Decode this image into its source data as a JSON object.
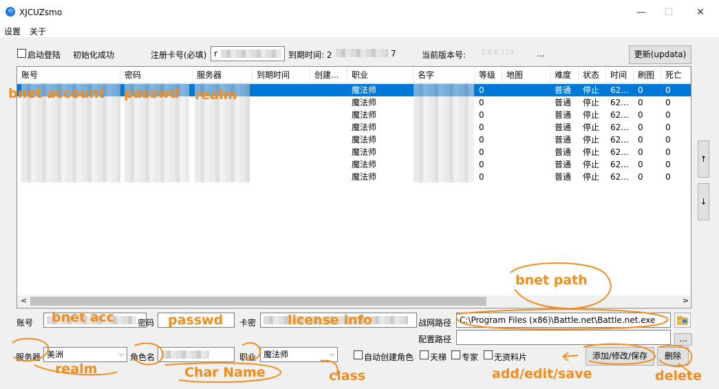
{
  "window": {
    "title": "XJCUZsmo",
    "minimize": "—",
    "maximize": "☐",
    "close": "✕"
  },
  "menu": [
    "设置",
    "关于"
  ],
  "toolbar": {
    "auto_login_label": "启动登陆",
    "init_status": "初始化成功",
    "reg_card_label": "注册卡号(必填)",
    "reg_card_value": "r",
    "expire_label": "到期时间: 2",
    "expire_tail": "7",
    "version_label": "当前版本号:",
    "version_value": "1.0.0.120",
    "version_more": "...",
    "update_button": "更新(updata)"
  },
  "table": {
    "columns": [
      "账号",
      "密码",
      "服务器",
      "到期时间",
      "创建...",
      "职业",
      "名字",
      "等级",
      "地图",
      "难度",
      "状态",
      "时间",
      "刷图",
      "死亡"
    ],
    "rows": [
      {
        "class": "魔法师",
        "level": "0",
        "difficulty": "普通",
        "state": "停止",
        "time": "62...",
        "runs": "0",
        "deaths": "0",
        "selected": true
      },
      {
        "class": "魔法师",
        "level": "0",
        "difficulty": "普通",
        "state": "停止",
        "time": "62...",
        "runs": "0",
        "deaths": "0",
        "selected": false
      },
      {
        "class": "魔法师",
        "level": "0",
        "difficulty": "普通",
        "state": "停止",
        "time": "62...",
        "runs": "0",
        "deaths": "0",
        "selected": false
      },
      {
        "class": "魔法师",
        "level": "0",
        "difficulty": "普通",
        "state": "停止",
        "time": "62...",
        "runs": "0",
        "deaths": "0",
        "selected": false
      },
      {
        "class": "魔法师",
        "level": "0",
        "difficulty": "普通",
        "state": "停止",
        "time": "62...",
        "runs": "0",
        "deaths": "0",
        "selected": false
      },
      {
        "class": "魔法师",
        "level": "0",
        "difficulty": "普通",
        "state": "停止",
        "time": "62...",
        "runs": "0",
        "deaths": "0",
        "selected": false
      },
      {
        "class": "魔法师",
        "level": "0",
        "difficulty": "普通",
        "state": "停止",
        "time": "62...",
        "runs": "0",
        "deaths": "0",
        "selected": false
      },
      {
        "class": "魔法师",
        "level": "0",
        "difficulty": "普通",
        "state": "停止",
        "time": "62...",
        "runs": "0",
        "deaths": "0",
        "selected": false
      }
    ],
    "scroll_left": "<",
    "scroll_right": ">"
  },
  "side": {
    "up": "↑",
    "down": "↓"
  },
  "form": {
    "account_label": "账号",
    "password_label": "密码",
    "card_key_label": "卡密",
    "bnet_path_label": "战网路径",
    "bnet_path_value": "C:\\Program Files (x86)\\Battle.net\\Battle.net.exe",
    "config_path_label": "配置路径",
    "browse_label": "...",
    "server_label": "服务器",
    "server_value": "美洲",
    "char_name_label": "角色名",
    "class_label": "职业",
    "class_value": "魔法师",
    "auto_create_label": "自动创建角色",
    "ladder_label": "天梯",
    "expert_label": "专家",
    "no_data_label": "无资料片",
    "save_button": "添加/修改/保存",
    "delete_button": "删除"
  },
  "annotations": {
    "bnet_account": "bnet account",
    "passwd_top": "passwd",
    "realm_top": "realm",
    "bnet_acc": "bnet acc",
    "passwd": "passwd",
    "license_info": "license info",
    "bnet_path": "bnet path",
    "realm": "realm",
    "char_name": "Char Name",
    "class": "class",
    "add_edit_save": "add/edit/save",
    "delete": "delete",
    "color": "#f28c1c"
  }
}
